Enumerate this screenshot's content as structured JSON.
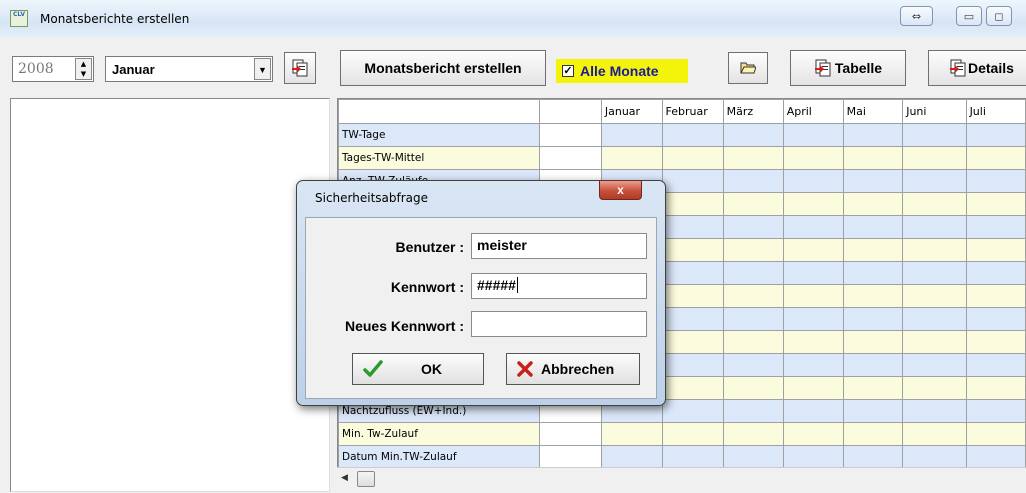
{
  "window": {
    "title": "Monatsberichte erstellen",
    "app_icon_text": "CLV",
    "controls": [
      "⇔",
      "▭",
      "◻"
    ]
  },
  "toolbar": {
    "year": "2008",
    "month": "Januar",
    "create_button": "Monatsbericht erstellen",
    "all_months_checked": true,
    "all_months_label": "Alle Monate",
    "table_button": "Tabelle",
    "details_button": "Details"
  },
  "grid": {
    "columns": [
      "",
      "",
      "Januar",
      "Februar",
      "März",
      "April",
      "Mai",
      "Juni",
      "Juli"
    ],
    "rows": [
      "TW-Tage",
      "Tages-TW-Mittel",
      "Anz. TW-Zuläufe",
      "",
      "",
      "",
      "",
      "",
      "",
      "",
      "",
      "",
      "Nachtzufluss (EW+Ind.)",
      "Min. Tw-Zulauf",
      "Datum Min.TW-Zulauf"
    ]
  },
  "dialog": {
    "title": "Sicherheitsabfrage",
    "close": "x",
    "user_label": "Benutzer :",
    "user_value": "meister",
    "password_label": "Kennwort :",
    "password_value": "#####",
    "new_password_label": "Neues Kennwort :",
    "new_password_value": "",
    "ok_label": "OK",
    "cancel_label": "Abbrechen"
  },
  "colors": {
    "row_blue": "#dbe8fa",
    "row_yellow": "#fbfbdd",
    "highlight": "#f4f40a",
    "checkbox_text": "#1a1a9c"
  }
}
